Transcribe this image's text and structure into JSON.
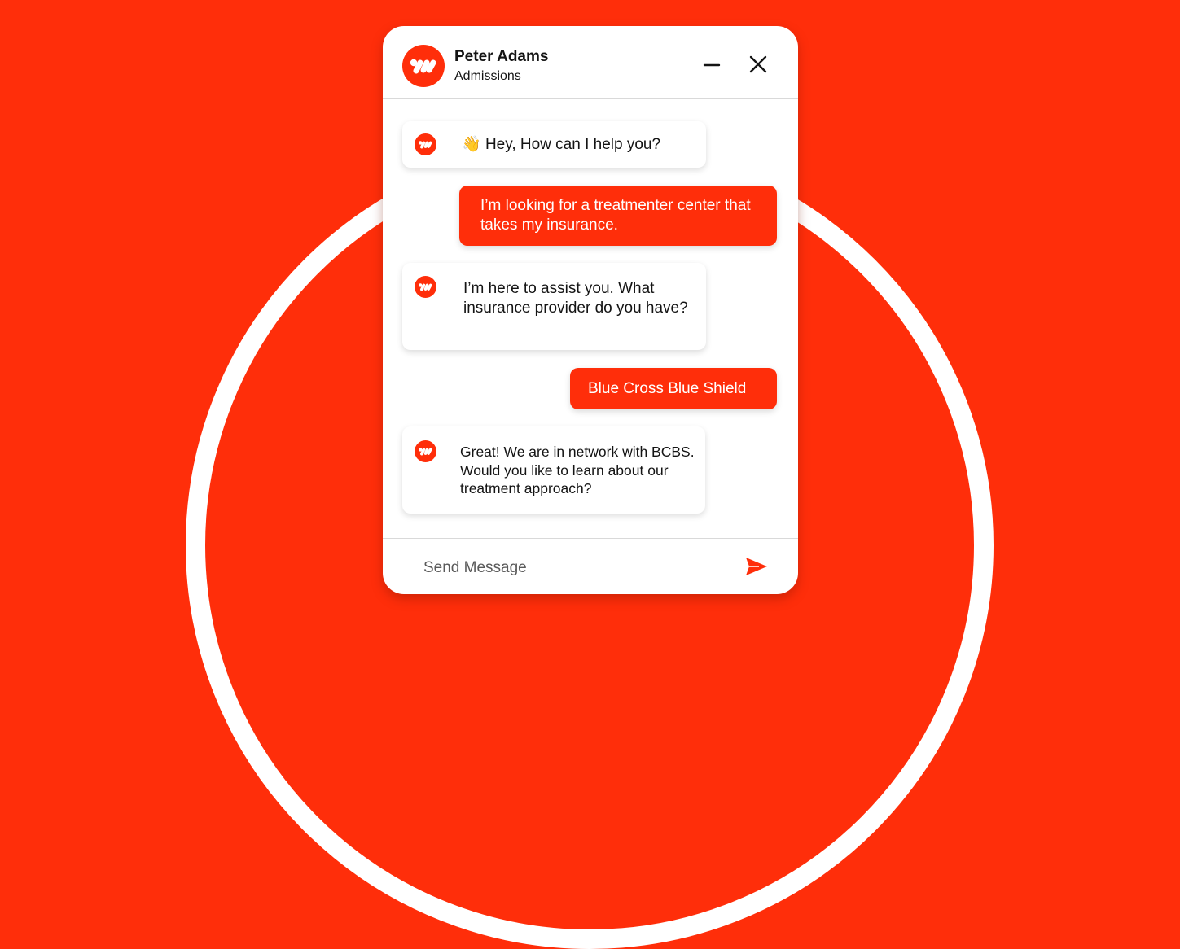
{
  "colors": {
    "accent": "#ff2e0a",
    "surface": "#ffffff",
    "text": "#141414"
  },
  "header": {
    "logo_icon": "brand-logo-icon",
    "agent_name": "Peter Adams",
    "department": "Admissions",
    "minimize_icon": "minus-icon",
    "close_icon": "close-icon"
  },
  "messages": [
    {
      "sender": "bot",
      "emoji": "👋",
      "text": "Hey, How can I help you?"
    },
    {
      "sender": "user",
      "text": "I’m looking for a treatmenter center that takes my insurance."
    },
    {
      "sender": "bot",
      "text": "I’m here to assist you. What insurance provider do you have?"
    },
    {
      "sender": "user",
      "text": "Blue Cross Blue Shield"
    },
    {
      "sender": "bot",
      "text": "Great! We are in network with BCBS. Would you like to learn about our treatment approach?"
    }
  ],
  "composer": {
    "placeholder": "Send Message",
    "value": "",
    "send_icon": "send-icon"
  }
}
